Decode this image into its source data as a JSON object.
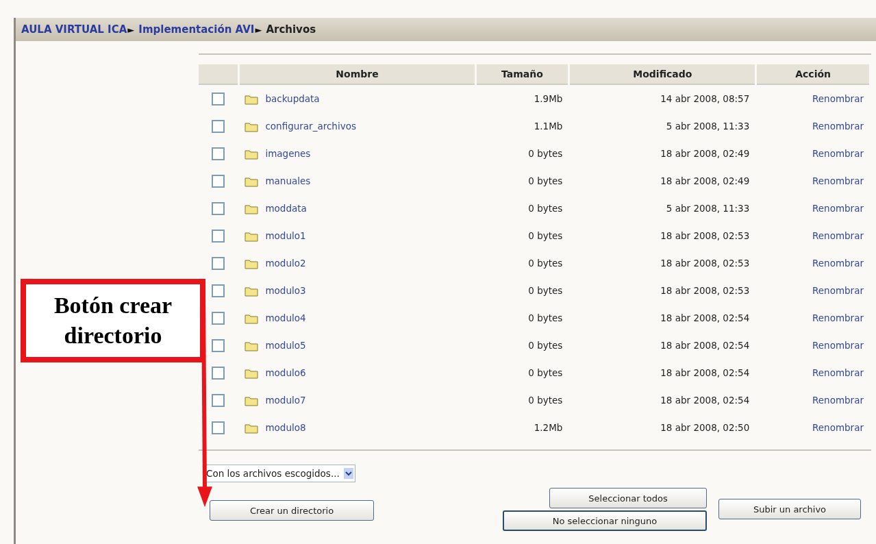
{
  "breadcrumb": [
    {
      "label": "AULA VIRTUAL ICA",
      "kind": "link",
      "separator": "►"
    },
    {
      "label": "Implementación AVI",
      "kind": "link",
      "separator": "►"
    },
    {
      "label": "Archivos",
      "kind": "current"
    }
  ],
  "table": {
    "columns": [
      "Nombre",
      "Tamaño",
      "Modificado",
      "Acción"
    ],
    "rows": [
      {
        "checked": false,
        "name": "backupdata",
        "size": "1.9Mb",
        "modified": "14 abr 2008, 08:57",
        "action": "Renombrar"
      },
      {
        "checked": false,
        "name": "configurar_archivos",
        "size": "1.1Mb",
        "modified": "5 abr 2008, 11:33",
        "action": "Renombrar"
      },
      {
        "checked": false,
        "name": "imagenes",
        "size": "0 bytes",
        "modified": "18 abr 2008, 02:49",
        "action": "Renombrar"
      },
      {
        "checked": false,
        "name": "manuales",
        "size": "0 bytes",
        "modified": "18 abr 2008, 02:49",
        "action": "Renombrar"
      },
      {
        "checked": false,
        "name": "moddata",
        "size": "0 bytes",
        "modified": "5 abr 2008, 11:33",
        "action": "Renombrar"
      },
      {
        "checked": false,
        "name": "modulo1",
        "size": "0 bytes",
        "modified": "18 abr 2008, 02:53",
        "action": "Renombrar"
      },
      {
        "checked": false,
        "name": "modulo2",
        "size": "0 bytes",
        "modified": "18 abr 2008, 02:53",
        "action": "Renombrar"
      },
      {
        "checked": false,
        "name": "modulo3",
        "size": "0 bytes",
        "modified": "18 abr 2008, 02:53",
        "action": "Renombrar"
      },
      {
        "checked": false,
        "name": "modulo4",
        "size": "0 bytes",
        "modified": "18 abr 2008, 02:54",
        "action": "Renombrar"
      },
      {
        "checked": false,
        "name": "modulo5",
        "size": "0 bytes",
        "modified": "18 abr 2008, 02:54",
        "action": "Renombrar"
      },
      {
        "checked": false,
        "name": "modulo6",
        "size": "0 bytes",
        "modified": "18 abr 2008, 02:54",
        "action": "Renombrar"
      },
      {
        "checked": false,
        "name": "modulo7",
        "size": "0 bytes",
        "modified": "18 abr 2008, 02:54",
        "action": "Renombrar"
      },
      {
        "checked": false,
        "name": "modulo8",
        "size": "1.2Mb",
        "modified": "18 abr 2008, 02:50",
        "action": "Renombrar"
      }
    ]
  },
  "bulk_action": {
    "value": "Con los archivos escogidos..."
  },
  "buttons": {
    "create_folder": "Crear un directorio",
    "select_all": "Seleccionar todos",
    "select_none": "No seleccionar ninguno",
    "upload": "Subir un archivo"
  },
  "callout": {
    "text": "Botón crear directorio"
  }
}
